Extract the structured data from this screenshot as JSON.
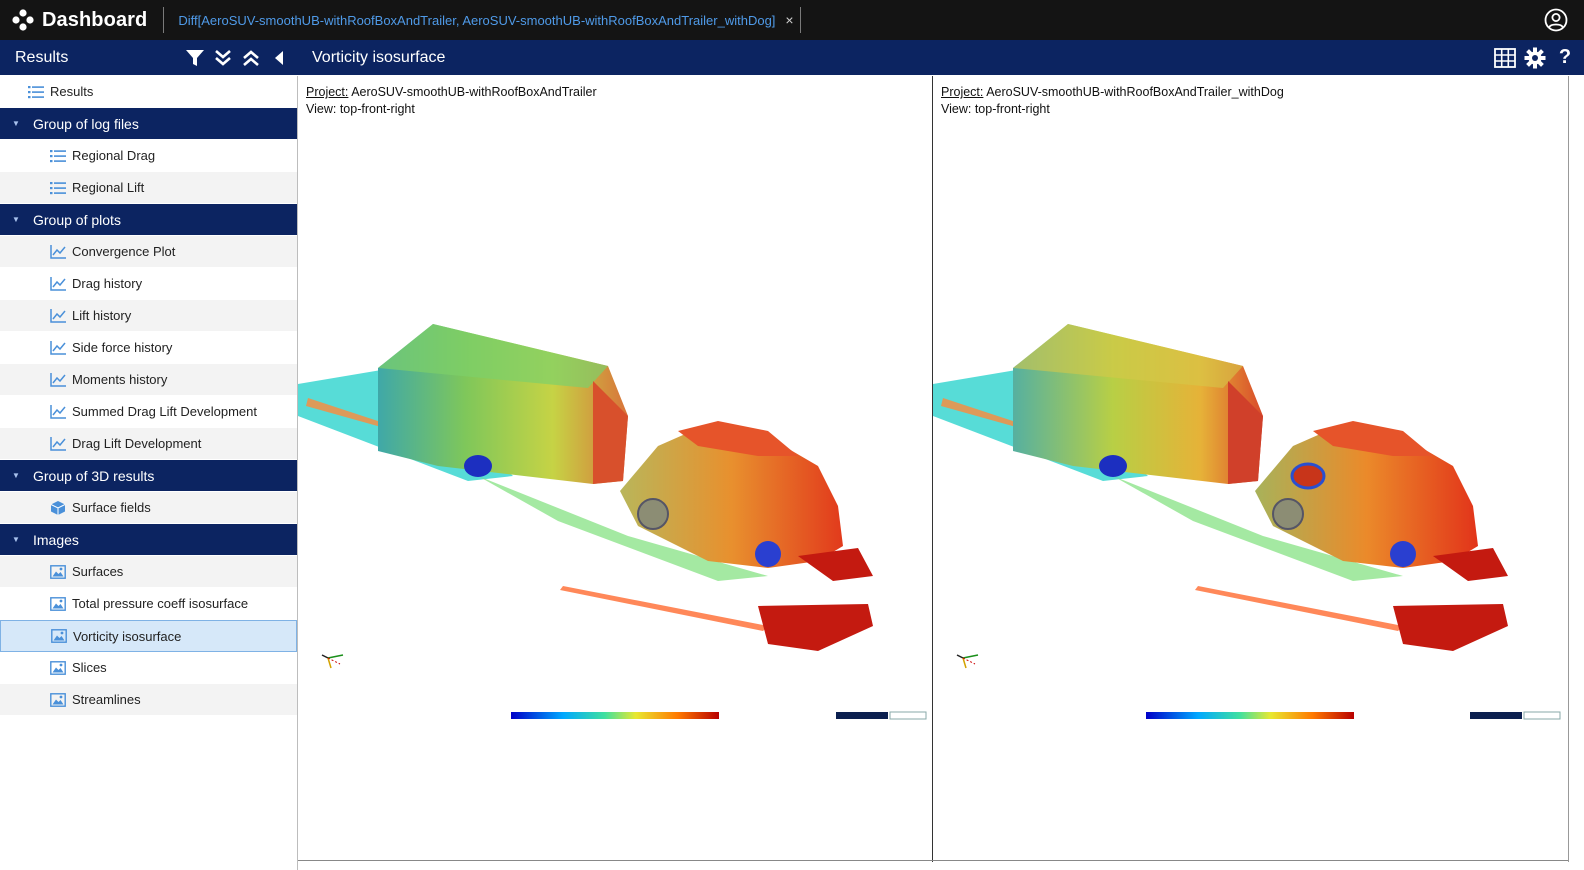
{
  "app": {
    "title": "Dashboard",
    "tab_label": "Diff[AeroSUV-smoothUB-withRoofBoxAndTrailer, AeroSUV-smoothUB-withRoofBoxAndTrailer_withDog]",
    "tab_close": "×"
  },
  "sidebar": {
    "title": "Results",
    "root_label": "Results",
    "groups": [
      {
        "label": "Group of log files",
        "items": [
          "Regional Drag",
          "Regional Lift"
        ]
      },
      {
        "label": "Group of plots",
        "items": [
          "Convergence Plot",
          "Drag history",
          "Lift history",
          "Side force history",
          "Moments history",
          "Summed Drag Lift Development",
          "Drag Lift Development"
        ]
      },
      {
        "label": "Group of 3D results",
        "items": [
          "Surface fields"
        ]
      },
      {
        "label": "Images",
        "items": [
          "Surfaces",
          "Total pressure coeff isosurface",
          "Vorticity isosurface",
          "Slices",
          "Streamlines"
        ]
      }
    ],
    "selected_item": "Vorticity isosurface"
  },
  "panel": {
    "title": "Vorticity isosurface",
    "help_label": "?"
  },
  "panes": [
    {
      "project_label": "Project:",
      "project": "AeroSUV-smoothUB-withRoofBoxAndTrailer",
      "view": "View: top-front-right"
    },
    {
      "project_label": "Project:",
      "project": "AeroSUV-smoothUB-withRoofBoxAndTrailer_withDog",
      "view": "View: top-front-right"
    }
  ],
  "icons": {
    "filter": "filter-icon",
    "expand_all": "chevrons-down-icon",
    "collapse_all": "chevrons-up-icon",
    "collapse_sidebar": "triangle-left-icon",
    "table": "grid-icon",
    "settings": "gear-icon",
    "user": "user-circle-icon"
  },
  "colors": {
    "topbar": "#141414",
    "header": "#0c2461",
    "tab_text": "#4f9ae8",
    "selected_row": "#d6e8f9"
  }
}
